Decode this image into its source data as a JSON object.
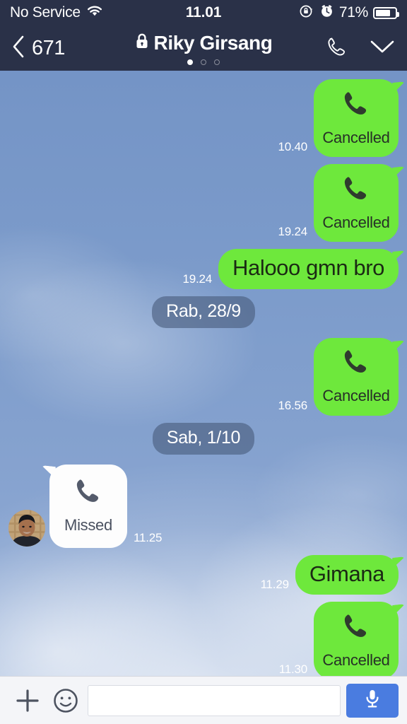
{
  "status_bar": {
    "carrier": "No Service",
    "wifi_icon": "wifi-icon",
    "time": "11.01",
    "rotation_lock_icon": "rotation-lock-icon",
    "alarm_icon": "alarm-clock-icon",
    "battery_percent": "71%",
    "battery_icon": "battery-icon"
  },
  "navbar": {
    "back_label": "671",
    "back_icon": "chevron-left-icon",
    "lock_icon": "lock-icon",
    "title": "Riky Girsang",
    "page_dots": 3,
    "active_dot": 0,
    "call_icon": "phone-icon",
    "collapse_icon": "chevron-down-icon"
  },
  "theme": {
    "header_bg": "#2a3148",
    "outgoing_bubble": "#6ee83c",
    "incoming_bubble": "#fdfdfd",
    "sky": "#7d9ccb",
    "date_pill": "#485c7c",
    "mic_button": "#4a7ce0"
  },
  "messages": [
    {
      "kind": "call",
      "direction": "out",
      "label": "Cancelled",
      "time": "10.40",
      "icon": "phone-handset-icon"
    },
    {
      "kind": "call",
      "direction": "out",
      "label": "Cancelled",
      "time": "19.24",
      "icon": "phone-handset-icon"
    },
    {
      "kind": "text",
      "direction": "out",
      "text": "Halooo gmn bro",
      "time": "19.24"
    },
    {
      "kind": "date",
      "label": "Rab, 28/9"
    },
    {
      "kind": "call",
      "direction": "out",
      "label": "Cancelled",
      "time": "16.56",
      "icon": "phone-handset-icon"
    },
    {
      "kind": "date",
      "label": "Sab, 1/10"
    },
    {
      "kind": "call",
      "direction": "in",
      "label": "Missed",
      "time": "11.25",
      "icon": "phone-handset-icon",
      "avatar": "contact-avatar"
    },
    {
      "kind": "text",
      "direction": "out",
      "text": "Gimana",
      "time": "11.29"
    },
    {
      "kind": "call",
      "direction": "out",
      "label": "Cancelled",
      "time": "11.30",
      "icon": "phone-handset-icon"
    }
  ],
  "composer": {
    "attach_icon": "plus-icon",
    "emoji_icon": "smiley-icon",
    "input_value": "",
    "input_placeholder": "",
    "mic_icon": "microphone-icon"
  }
}
